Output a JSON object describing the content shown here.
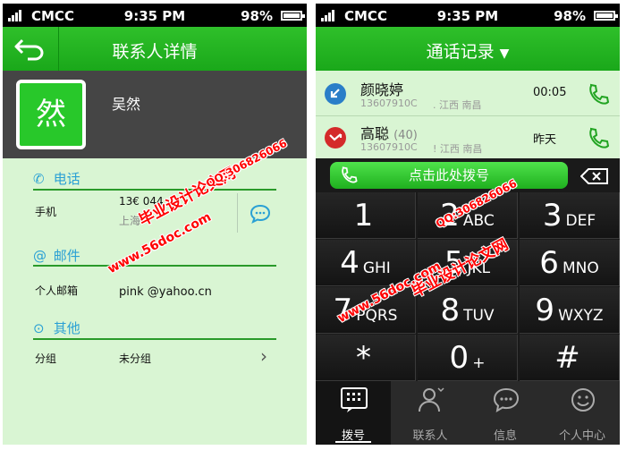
{
  "status_bar": {
    "carrier": "CMCC",
    "time": "9:35 PM",
    "battery": "98%"
  },
  "contact_detail": {
    "title": "联系人详情",
    "avatar_char": "然",
    "name": "吴然",
    "phone_section": {
      "heading": "电话",
      "label": "手机",
      "number": "13€   044",
      "location": "上海"
    },
    "email_section": {
      "heading": "邮件",
      "label": "个人邮箱",
      "value": "pink    @yahoo.cn"
    },
    "other_section": {
      "heading": "其他",
      "label": "分组",
      "value": "未分组"
    }
  },
  "call_log": {
    "title": "通话记录",
    "entries": [
      {
        "name": "颜晓婷",
        "count": "",
        "number": "13607910C",
        "location": ". 江西 南昌",
        "time": "00:05",
        "type": "incoming"
      },
      {
        "name": "高聪",
        "count": "(40)",
        "number": "13607910C",
        "location": "! 江西 南昌",
        "time": "昨天",
        "type": "missed"
      }
    ],
    "dial_prompt": "点击此处拨号",
    "keypad": [
      {
        "digit": "1",
        "letters": ""
      },
      {
        "digit": "2",
        "letters": "ABC"
      },
      {
        "digit": "3",
        "letters": "DEF"
      },
      {
        "digit": "4",
        "letters": "GHI"
      },
      {
        "digit": "5",
        "letters": "JKL"
      },
      {
        "digit": "6",
        "letters": "MNO"
      },
      {
        "digit": "7",
        "letters": "PQRS"
      },
      {
        "digit": "8",
        "letters": "TUV"
      },
      {
        "digit": "9",
        "letters": "WXYZ"
      },
      {
        "digit": "*",
        "letters": ""
      },
      {
        "digit": "0",
        "letters": "+"
      },
      {
        "digit": "#",
        "letters": ""
      }
    ],
    "tabs": [
      {
        "label": "拨号",
        "icon": "keypad-icon"
      },
      {
        "label": "联系人",
        "icon": "contact-icon"
      },
      {
        "label": "信息",
        "icon": "message-icon"
      },
      {
        "label": "个人中心",
        "icon": "smiley-icon"
      }
    ]
  },
  "watermarks": {
    "site_name": "毕业设计论文网",
    "site_url": "www.56doc.com",
    "qq": "QQ:306826066"
  },
  "colors": {
    "brand_green": "#1faf1f",
    "heading_blue": "#2aa0d4",
    "watermark_red": "#ff0000"
  }
}
